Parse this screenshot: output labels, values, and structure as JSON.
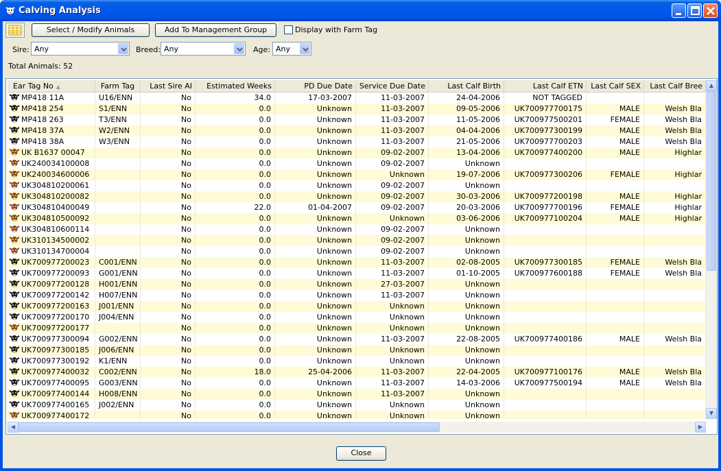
{
  "window": {
    "title": "Calving Analysis",
    "icon": "cow-icon"
  },
  "toolbar": {
    "select_modify_label": "Select / Modify Animals",
    "add_group_label": "Add To Management Group",
    "display_farm_tag_label": "Display with Farm Tag",
    "display_farm_tag_checked": false
  },
  "filters": {
    "sire_label": "Sire:",
    "sire_value": "Any",
    "breed_label": "Breed:",
    "breed_value": "Any",
    "age_label": "Age:",
    "age_value": "Any"
  },
  "total_animals": "Total Animals: 52",
  "table": {
    "columns": [
      "Ear Tag No",
      "Farm Tag",
      "Last Sire AI",
      "Estimated Weeks",
      "PD Due Date",
      "Service Due Date",
      "Last Calf Birth",
      "Last Calf ETN",
      "Last Calf SEX",
      "Last Calf Bree"
    ],
    "rows": [
      {
        "tag": "MP418 11A",
        "farm": "U16/ENN",
        "ai": "No",
        "weeks": "34.0",
        "pd": "17-03-2007",
        "svc": "11-03-2007",
        "birth": "24-04-2006",
        "etn": "NOT TAGGED",
        "sex": "",
        "breed": "",
        "icon": "black",
        "hl": false
      },
      {
        "tag": "MP418 254",
        "farm": "S1/ENN",
        "ai": "No",
        "weeks": "0.0",
        "pd": "Unknown",
        "svc": "11-03-2007",
        "birth": "09-05-2006",
        "etn": "UK700977700175",
        "sex": "MALE",
        "breed": "Welsh Bla",
        "icon": "black",
        "hl": true
      },
      {
        "tag": "MP418 263",
        "farm": "T3/ENN",
        "ai": "No",
        "weeks": "0.0",
        "pd": "Unknown",
        "svc": "11-03-2007",
        "birth": "11-05-2006",
        "etn": "UK700977500201",
        "sex": "FEMALE",
        "breed": "Welsh Bla",
        "icon": "black",
        "hl": false
      },
      {
        "tag": "MP418 37A",
        "farm": "W2/ENN",
        "ai": "No",
        "weeks": "0.0",
        "pd": "Unknown",
        "svc": "11-03-2007",
        "birth": "04-04-2006",
        "etn": "UK700977300199",
        "sex": "MALE",
        "breed": "Welsh Bla",
        "icon": "black",
        "hl": true
      },
      {
        "tag": "MP418 38A",
        "farm": "W3/ENN",
        "ai": "No",
        "weeks": "0.0",
        "pd": "Unknown",
        "svc": "11-03-2007",
        "birth": "21-05-2006",
        "etn": "UK700977700203",
        "sex": "MALE",
        "breed": "Welsh Bla",
        "icon": "black",
        "hl": false
      },
      {
        "tag": "UK B1637 00047",
        "farm": "",
        "ai": "No",
        "weeks": "0.0",
        "pd": "Unknown",
        "svc": "09-02-2007",
        "birth": "13-04-2006",
        "etn": "UK700977400200",
        "sex": "MALE",
        "breed": "Highlar",
        "icon": "brown",
        "hl": true
      },
      {
        "tag": "UK240034100008",
        "farm": "",
        "ai": "No",
        "weeks": "0.0",
        "pd": "Unknown",
        "svc": "09-02-2007",
        "birth": "Unknown",
        "etn": "",
        "sex": "",
        "breed": "",
        "icon": "brown",
        "hl": false
      },
      {
        "tag": "UK240034600006",
        "farm": "",
        "ai": "No",
        "weeks": "0.0",
        "pd": "Unknown",
        "svc": "Unknown",
        "birth": "19-07-2006",
        "etn": "UK700977300206",
        "sex": "FEMALE",
        "breed": "Highlar",
        "icon": "brown",
        "hl": true
      },
      {
        "tag": "UK304810200061",
        "farm": "",
        "ai": "No",
        "weeks": "0.0",
        "pd": "Unknown",
        "svc": "09-02-2007",
        "birth": "Unknown",
        "etn": "",
        "sex": "",
        "breed": "",
        "icon": "brown",
        "hl": false
      },
      {
        "tag": "UK304810200082",
        "farm": "",
        "ai": "No",
        "weeks": "0.0",
        "pd": "Unknown",
        "svc": "09-02-2007",
        "birth": "30-03-2006",
        "etn": "UK700977200198",
        "sex": "MALE",
        "breed": "Highlar",
        "icon": "brown",
        "hl": true
      },
      {
        "tag": "UK304810400049",
        "farm": "",
        "ai": "No",
        "weeks": "22.0",
        "pd": "01-04-2007",
        "svc": "09-02-2007",
        "birth": "20-03-2006",
        "etn": "UK700977700196",
        "sex": "FEMALE",
        "breed": "Highlar",
        "icon": "brown",
        "hl": false
      },
      {
        "tag": "UK304810500092",
        "farm": "",
        "ai": "No",
        "weeks": "0.0",
        "pd": "Unknown",
        "svc": "Unknown",
        "birth": "03-06-2006",
        "etn": "UK700977100204",
        "sex": "MALE",
        "breed": "Highlar",
        "icon": "brown",
        "hl": true
      },
      {
        "tag": "UK304810600114",
        "farm": "",
        "ai": "No",
        "weeks": "0.0",
        "pd": "Unknown",
        "svc": "09-02-2007",
        "birth": "Unknown",
        "etn": "",
        "sex": "",
        "breed": "",
        "icon": "brown",
        "hl": false
      },
      {
        "tag": "UK310134500002",
        "farm": "",
        "ai": "No",
        "weeks": "0.0",
        "pd": "Unknown",
        "svc": "09-02-2007",
        "birth": "Unknown",
        "etn": "",
        "sex": "",
        "breed": "",
        "icon": "brown",
        "hl": true
      },
      {
        "tag": "UK310134700004",
        "farm": "",
        "ai": "No",
        "weeks": "0.0",
        "pd": "Unknown",
        "svc": "09-02-2007",
        "birth": "Unknown",
        "etn": "",
        "sex": "",
        "breed": "",
        "icon": "brown",
        "hl": false
      },
      {
        "tag": "UK700977200023",
        "farm": "C001/ENN",
        "ai": "No",
        "weeks": "0.0",
        "pd": "Unknown",
        "svc": "11-03-2007",
        "birth": "02-08-2005",
        "etn": "UK700977300185",
        "sex": "FEMALE",
        "breed": "Welsh Bla",
        "icon": "black",
        "hl": true
      },
      {
        "tag": "UK700977200093",
        "farm": "G001/ENN",
        "ai": "No",
        "weeks": "0.0",
        "pd": "Unknown",
        "svc": "11-03-2007",
        "birth": "01-10-2005",
        "etn": "UK700977600188",
        "sex": "FEMALE",
        "breed": "Welsh Bla",
        "icon": "black",
        "hl": false
      },
      {
        "tag": "UK700977200128",
        "farm": "H001/ENN",
        "ai": "No",
        "weeks": "0.0",
        "pd": "Unknown",
        "svc": "27-03-2007",
        "birth": "Unknown",
        "etn": "",
        "sex": "",
        "breed": "",
        "icon": "black",
        "hl": true
      },
      {
        "tag": "UK700977200142",
        "farm": "H007/ENN",
        "ai": "No",
        "weeks": "0.0",
        "pd": "Unknown",
        "svc": "11-03-2007",
        "birth": "Unknown",
        "etn": "",
        "sex": "",
        "breed": "",
        "icon": "black",
        "hl": false
      },
      {
        "tag": "UK700977200163",
        "farm": "J001/ENN",
        "ai": "No",
        "weeks": "0.0",
        "pd": "Unknown",
        "svc": "Unknown",
        "birth": "Unknown",
        "etn": "",
        "sex": "",
        "breed": "",
        "icon": "black",
        "hl": true
      },
      {
        "tag": "UK700977200170",
        "farm": "J004/ENN",
        "ai": "No",
        "weeks": "0.0",
        "pd": "Unknown",
        "svc": "Unknown",
        "birth": "Unknown",
        "etn": "",
        "sex": "",
        "breed": "",
        "icon": "black",
        "hl": false
      },
      {
        "tag": "UK700977200177",
        "farm": "",
        "ai": "No",
        "weeks": "0.0",
        "pd": "Unknown",
        "svc": "Unknown",
        "birth": "Unknown",
        "etn": "",
        "sex": "",
        "breed": "",
        "icon": "brown",
        "hl": true
      },
      {
        "tag": "UK700977300094",
        "farm": "G002/ENN",
        "ai": "No",
        "weeks": "0.0",
        "pd": "Unknown",
        "svc": "11-03-2007",
        "birth": "22-08-2005",
        "etn": "UK700977400186",
        "sex": "MALE",
        "breed": "Welsh Bla",
        "icon": "black",
        "hl": false
      },
      {
        "tag": "UK700977300185",
        "farm": "J006/ENN",
        "ai": "No",
        "weeks": "0.0",
        "pd": "Unknown",
        "svc": "Unknown",
        "birth": "Unknown",
        "etn": "",
        "sex": "",
        "breed": "",
        "icon": "black",
        "hl": true
      },
      {
        "tag": "UK700977300192",
        "farm": "K1/ENN",
        "ai": "No",
        "weeks": "0.0",
        "pd": "Unknown",
        "svc": "Unknown",
        "birth": "Unknown",
        "etn": "",
        "sex": "",
        "breed": "",
        "icon": "black",
        "hl": false
      },
      {
        "tag": "UK700977400032",
        "farm": "C002/ENN",
        "ai": "No",
        "weeks": "18.0",
        "pd": "25-04-2006",
        "svc": "11-03-2007",
        "birth": "22-04-2005",
        "etn": "UK700977100176",
        "sex": "MALE",
        "breed": "Welsh Bla",
        "icon": "black",
        "hl": true
      },
      {
        "tag": "UK700977400095",
        "farm": "G003/ENN",
        "ai": "No",
        "weeks": "0.0",
        "pd": "Unknown",
        "svc": "11-03-2007",
        "birth": "14-03-2006",
        "etn": "UK700977500194",
        "sex": "MALE",
        "breed": "Welsh Bla",
        "icon": "black",
        "hl": false
      },
      {
        "tag": "UK700977400144",
        "farm": "H008/ENN",
        "ai": "No",
        "weeks": "0.0",
        "pd": "Unknown",
        "svc": "11-03-2007",
        "birth": "Unknown",
        "etn": "",
        "sex": "",
        "breed": "",
        "icon": "black",
        "hl": true
      },
      {
        "tag": "UK700977400165",
        "farm": "J002/ENN",
        "ai": "No",
        "weeks": "0.0",
        "pd": "Unknown",
        "svc": "Unknown",
        "birth": "Unknown",
        "etn": "",
        "sex": "",
        "breed": "",
        "icon": "black",
        "hl": false
      },
      {
        "tag": "UK700977400172",
        "farm": "",
        "ai": "No",
        "weeks": "0.0",
        "pd": "Unknown",
        "svc": "Unknown",
        "birth": "Unknown",
        "etn": "",
        "sex": "",
        "breed": "",
        "icon": "brown",
        "hl": true
      }
    ]
  },
  "close_label": "Close",
  "colors": {
    "titlebar": "#0054e3",
    "row_highlight": "#fefbd6",
    "window_bg": "#ece9d8",
    "cow_black": "#1a1a1a",
    "cow_brown": "#8a4a12"
  }
}
